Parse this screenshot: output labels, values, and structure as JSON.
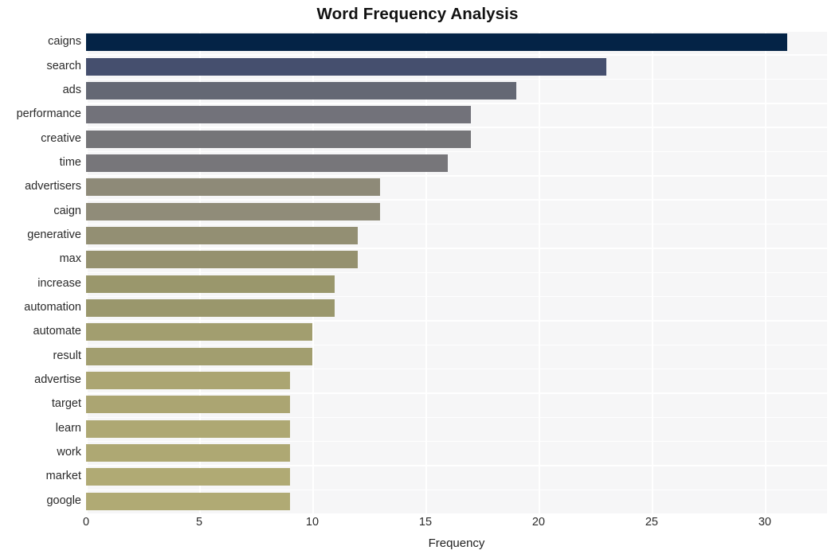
{
  "chart_data": {
    "type": "bar",
    "orientation": "horizontal",
    "title": "Word Frequency Analysis",
    "xlabel": "Frequency",
    "ylabel": "",
    "categories": [
      "caigns",
      "search",
      "ads",
      "performance",
      "creative",
      "time",
      "advertisers",
      "caign",
      "generative",
      "max",
      "increase",
      "automation",
      "automate",
      "result",
      "advertise",
      "target",
      "learn",
      "work",
      "market",
      "google"
    ],
    "values": [
      31,
      23,
      19,
      17,
      17,
      16,
      13,
      13,
      12,
      12,
      11,
      11,
      10,
      10,
      9,
      9,
      9,
      9,
      9,
      9
    ],
    "bar_colors": [
      "#042346",
      "#454f6e",
      "#646874",
      "#72727a",
      "#757578",
      "#77767a",
      "#8e8a78",
      "#908c79",
      "#938f73",
      "#95916f",
      "#9a976c",
      "#9a976c",
      "#a29e6f",
      "#a29e6f",
      "#aba572",
      "#aba572",
      "#aea873",
      "#aea873",
      "#b0aa74",
      "#b0aa74"
    ],
    "xlim": [
      0,
      32.75
    ],
    "xticks": [
      0,
      5,
      10,
      15,
      20,
      25,
      30
    ],
    "xtick_labels": [
      "0",
      "5",
      "10",
      "15",
      "20",
      "25",
      "30"
    ],
    "grid": true,
    "grid_color": "#ffffff",
    "plot_background": "#f6f6f7",
    "figure_background": "#ffffff",
    "legend": null
  }
}
